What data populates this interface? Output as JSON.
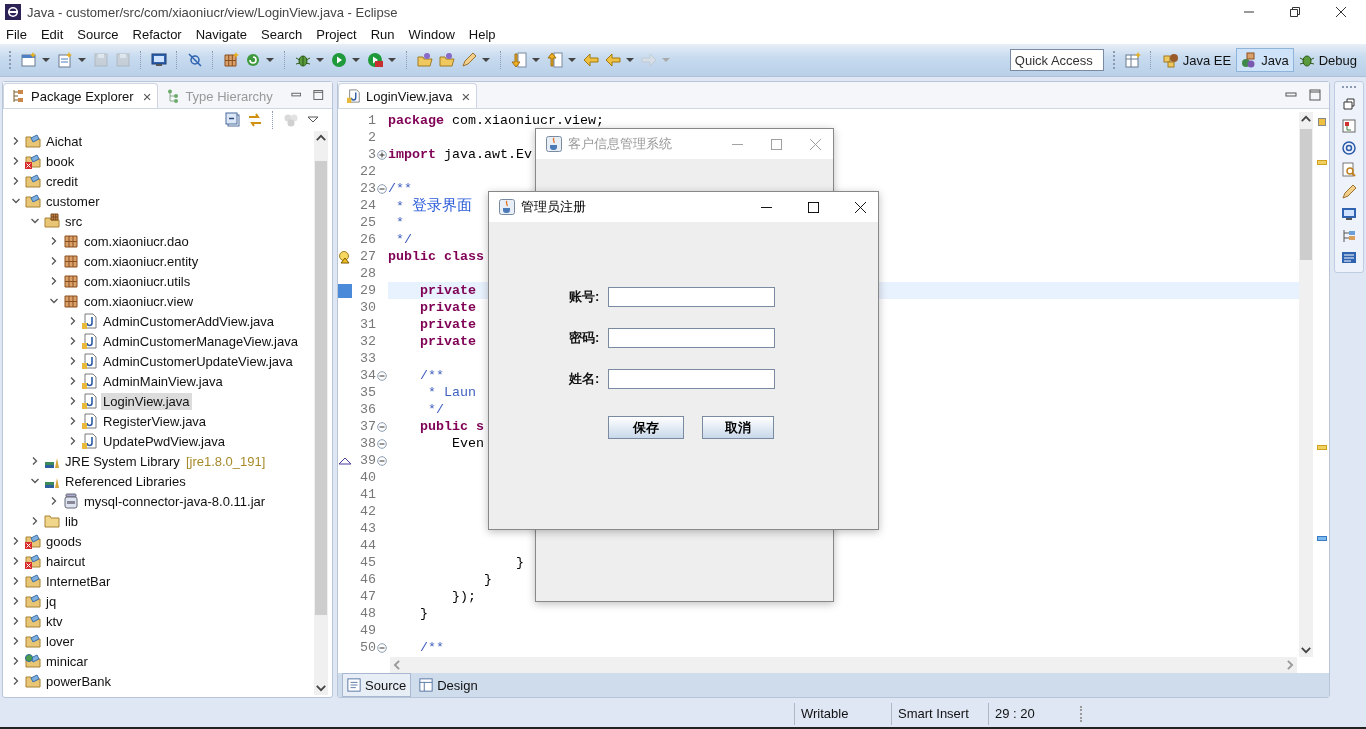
{
  "window": {
    "title": "Java - customer/src/com/xiaoniucr/view/LoginView.java - Eclipse"
  },
  "menu": [
    "File",
    "Edit",
    "Source",
    "Refactor",
    "Navigate",
    "Search",
    "Project",
    "Run",
    "Window",
    "Help"
  ],
  "quick_access": {
    "placeholder": "Quick Access"
  },
  "perspectives": [
    {
      "label": "Java EE",
      "selected": false
    },
    {
      "label": "Java",
      "selected": true
    },
    {
      "label": "Debug",
      "selected": false
    }
  ],
  "left_panel": {
    "tabs": [
      {
        "label": "Package Explorer",
        "selected": true,
        "close": "×"
      },
      {
        "label": "Type Hierarchy",
        "selected": false
      }
    ],
    "tree": [
      {
        "label": "Aichat",
        "kind": "project",
        "expanded": false,
        "selected": false
      },
      {
        "label": "book",
        "kind": "project-error",
        "expanded": false,
        "selected": false
      },
      {
        "label": "credit",
        "kind": "project",
        "expanded": false,
        "selected": false
      },
      {
        "label": "customer",
        "kind": "project",
        "expanded": true,
        "selected": false,
        "children": [
          {
            "label": "src",
            "kind": "source-folder",
            "expanded": true,
            "selected": false,
            "children": [
              {
                "label": "com.xiaoniucr.dao",
                "kind": "package",
                "expanded": false,
                "selected": false
              },
              {
                "label": "com.xiaoniucr.entity",
                "kind": "package",
                "expanded": false,
                "selected": false
              },
              {
                "label": "com.xiaoniucr.utils",
                "kind": "package",
                "expanded": false,
                "selected": false
              },
              {
                "label": "com.xiaoniucr.view",
                "kind": "package",
                "expanded": true,
                "selected": false,
                "children": [
                  {
                    "label": "AdminCustomerAddView.java",
                    "kind": "java-file",
                    "expanded": false,
                    "selected": false
                  },
                  {
                    "label": "AdminCustomerManageView.java",
                    "kind": "java-file",
                    "expanded": false,
                    "selected": false
                  },
                  {
                    "label": "AdminCustomerUpdateView.java",
                    "kind": "java-file",
                    "expanded": false,
                    "selected": false
                  },
                  {
                    "label": "AdminMainView.java",
                    "kind": "java-file",
                    "expanded": false,
                    "selected": false
                  },
                  {
                    "label": "LoginView.java",
                    "kind": "java-file",
                    "expanded": false,
                    "selected": true
                  },
                  {
                    "label": "RegisterView.java",
                    "kind": "java-file",
                    "expanded": false,
                    "selected": false
                  },
                  {
                    "label": "UpdatePwdView.java",
                    "kind": "java-file",
                    "expanded": false,
                    "selected": false
                  }
                ]
              }
            ]
          },
          {
            "label": "JRE System Library",
            "decoration": "[jre1.8.0_191]",
            "kind": "library",
            "expanded": false,
            "selected": false
          },
          {
            "label": "Referenced Libraries",
            "kind": "library",
            "expanded": true,
            "selected": false,
            "children": [
              {
                "label": "mysql-connector-java-8.0.11.jar",
                "kind": "jar",
                "expanded": false,
                "selected": false
              }
            ]
          },
          {
            "label": "lib",
            "kind": "folder",
            "expanded": false,
            "selected": false
          }
        ]
      },
      {
        "label": "goods",
        "kind": "project-error",
        "expanded": false,
        "selected": false
      },
      {
        "label": "haircut",
        "kind": "project-error",
        "expanded": false,
        "selected": false
      },
      {
        "label": "InternetBar",
        "kind": "project",
        "expanded": false,
        "selected": false
      },
      {
        "label": "jq",
        "kind": "project",
        "expanded": false,
        "selected": false
      },
      {
        "label": "ktv",
        "kind": "project",
        "expanded": false,
        "selected": false
      },
      {
        "label": "lover",
        "kind": "project",
        "expanded": false,
        "selected": false
      },
      {
        "label": "minicar",
        "kind": "web-project",
        "expanded": false,
        "selected": false
      },
      {
        "label": "powerBank",
        "kind": "project",
        "expanded": false,
        "selected": false
      }
    ]
  },
  "editor": {
    "tabs": [
      {
        "label": "LoginView.java",
        "selected": true,
        "close": "×"
      }
    ],
    "lines": [
      {
        "number": "1",
        "current": false,
        "kind": "plain",
        "segments": [
          {
            "kind": "keyword",
            "text": "package"
          },
          {
            "kind": "plain",
            "text": " com.xiaoniucr.view;"
          }
        ]
      },
      {
        "number": "2",
        "current": false,
        "kind": "plain"
      },
      {
        "number": "3",
        "current": false,
        "kind": "plain",
        "folded": true,
        "segments": [
          {
            "kind": "keyword",
            "text": "import"
          },
          {
            "kind": "plain",
            "text": " java.awt.Ev"
          }
        ]
      },
      {
        "number": "22",
        "current": false,
        "kind": "plain"
      },
      {
        "number": "23",
        "current": false,
        "kind": "plain",
        "folded": false,
        "segments": [
          {
            "kind": "comment",
            "text": "/**"
          }
        ]
      },
      {
        "number": "24",
        "current": false,
        "kind": "plain",
        "segments": [
          {
            "kind": "comment",
            "text": " * "
          },
          {
            "kind": "comment-cjk",
            "text": "登录界面"
          }
        ]
      },
      {
        "number": "25",
        "current": false,
        "kind": "plain",
        "segments": [
          {
            "kind": "comment",
            "text": " *"
          }
        ]
      },
      {
        "number": "26",
        "current": false,
        "kind": "plain",
        "segments": [
          {
            "kind": "comment",
            "text": " */"
          }
        ]
      },
      {
        "number": "27",
        "current": false,
        "kind": "warning",
        "segments": [
          {
            "kind": "keyword",
            "text": "public class"
          }
        ]
      },
      {
        "number": "28",
        "current": false,
        "kind": "plain"
      },
      {
        "number": "29",
        "current": true,
        "kind": "occurrence",
        "segments": [
          {
            "kind": "keyword",
            "text": "    private"
          }
        ]
      },
      {
        "number": "30",
        "current": false,
        "kind": "plain",
        "segments": [
          {
            "kind": "keyword",
            "text": "    private"
          }
        ]
      },
      {
        "number": "31",
        "current": false,
        "kind": "plain",
        "segments": [
          {
            "kind": "keyword",
            "text": "    private"
          }
        ]
      },
      {
        "number": "32",
        "current": false,
        "kind": "plain",
        "segments": [
          {
            "kind": "keyword",
            "text": "    private"
          }
        ]
      },
      {
        "number": "33",
        "current": false,
        "kind": "plain"
      },
      {
        "number": "34",
        "current": false,
        "kind": "plain",
        "folded": false,
        "segments": [
          {
            "kind": "comment",
            "text": "    /**"
          }
        ]
      },
      {
        "number": "35",
        "current": false,
        "kind": "plain",
        "segments": [
          {
            "kind": "comment",
            "text": "     * Laun"
          }
        ]
      },
      {
        "number": "36",
        "current": false,
        "kind": "plain",
        "segments": [
          {
            "kind": "comment",
            "text": "     */"
          }
        ]
      },
      {
        "number": "37",
        "current": false,
        "kind": "plain",
        "folded": false,
        "segments": [
          {
            "kind": "keyword",
            "text": "    public s"
          }
        ]
      },
      {
        "number": "38",
        "current": false,
        "kind": "plain",
        "folded": false,
        "segments": [
          {
            "kind": "plain",
            "text": "        Even"
          }
        ]
      },
      {
        "number": "39",
        "current": false,
        "kind": "override",
        "folded": false
      },
      {
        "number": "40",
        "current": false,
        "kind": "plain"
      },
      {
        "number": "41",
        "current": false,
        "kind": "plain"
      },
      {
        "number": "42",
        "current": false,
        "kind": "plain"
      },
      {
        "number": "43",
        "current": false,
        "kind": "plain"
      },
      {
        "number": "44",
        "current": false,
        "kind": "plain"
      },
      {
        "number": "45",
        "current": false,
        "kind": "plain",
        "segments": [
          {
            "kind": "plain",
            "text": "                }"
          }
        ]
      },
      {
        "number": "46",
        "current": false,
        "kind": "plain",
        "segments": [
          {
            "kind": "plain",
            "text": "            }"
          }
        ]
      },
      {
        "number": "47",
        "current": false,
        "kind": "plain",
        "segments": [
          {
            "kind": "plain",
            "text": "        });"
          }
        ]
      },
      {
        "number": "48",
        "current": false,
        "kind": "plain",
        "segments": [
          {
            "kind": "plain",
            "text": "    }"
          }
        ]
      },
      {
        "number": "49",
        "current": false,
        "kind": "plain"
      },
      {
        "number": "50",
        "current": false,
        "kind": "plain",
        "folded": false,
        "segments": [
          {
            "kind": "comment",
            "text": "    /**"
          }
        ]
      }
    ],
    "bottom_tabs": [
      {
        "label": "Source",
        "selected": true
      },
      {
        "label": "Design",
        "selected": false
      }
    ]
  },
  "dialogs": [
    {
      "title": "客户信息管理系统",
      "active": false
    },
    {
      "title": "管理员注册",
      "active": true,
      "fields": [
        {
          "label": "账号:"
        },
        {
          "label": "密码:"
        },
        {
          "label": "姓名:"
        }
      ],
      "buttons": [
        "保存",
        "取消"
      ]
    }
  ],
  "status_bar": [
    "Writable",
    "Smart Insert",
    "29 : 20"
  ]
}
